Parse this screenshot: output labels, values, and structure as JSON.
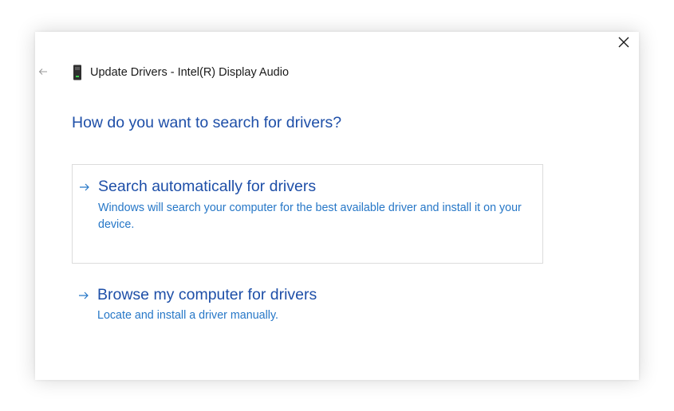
{
  "window": {
    "title": "Update Drivers - Intel(R) Display Audio",
    "close_icon": "close-icon",
    "back_icon": "back-arrow-icon",
    "device_icon": "device-icon"
  },
  "heading": "How do you want to search for drivers?",
  "options": [
    {
      "icon": "arrow-right-icon",
      "title": "Search automatically for drivers",
      "description": "Windows will search your computer for the best available driver and install it on your device."
    },
    {
      "icon": "arrow-right-icon",
      "title": "Browse my computer for drivers",
      "description": "Locate and install a driver manually."
    }
  ],
  "colors": {
    "heading": "#1e4fa8",
    "link": "#2677c7",
    "border": "#dcdcdc"
  }
}
